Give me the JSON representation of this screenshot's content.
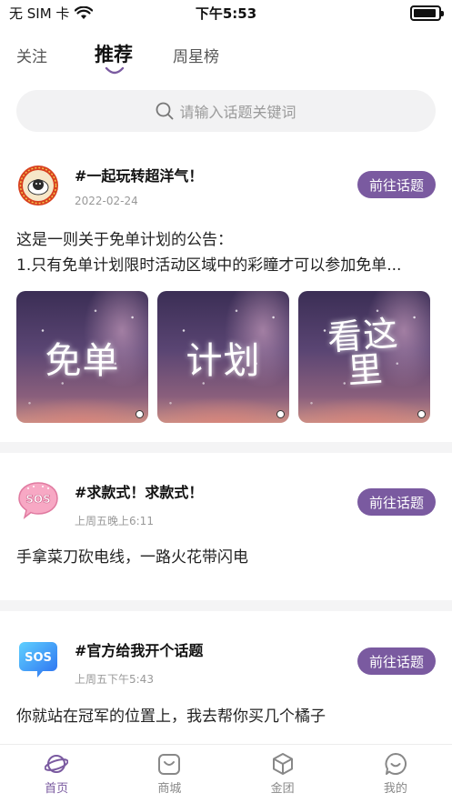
{
  "status_bar": {
    "carrier": "无 SIM 卡",
    "time": "下午5:53"
  },
  "tabs": [
    {
      "label": "关注",
      "active": false
    },
    {
      "label": "推荐",
      "active": true
    },
    {
      "label": "周星榜",
      "active": false
    }
  ],
  "search": {
    "placeholder": "请输入话题关键词"
  },
  "accent_color": "#7a5aa0",
  "posts": [
    {
      "title": "#一起玩转超洋气！",
      "date": "2022-02-24",
      "button": "前往话题",
      "body_line1": "这是一则关于免单计划的公告：",
      "body_line2": "1.只有免单计划限时活动区域中的彩瞳才可以参加免单...",
      "avatar_icon": "sheep-badge-icon",
      "images": [
        {
          "text": "免单"
        },
        {
          "text": "计划"
        },
        {
          "text_top": "看这",
          "text_bottom": "里"
        }
      ]
    },
    {
      "title": "#求款式！求款式！",
      "date": "上周五晚上6:11",
      "button": "前往话题",
      "body": "手拿菜刀砍电线，一路火花带闪电",
      "avatar_icon": "sos-pink-bubble-icon"
    },
    {
      "title": "#官方给我开个话题",
      "date": "上周五下午5:43",
      "button": "前往话题",
      "body": "你就站在冠军的位置上，我去帮你买几个橘子",
      "avatar_icon": "sos-blue-bubble-icon"
    }
  ],
  "bottom_nav": [
    {
      "label": "首页",
      "icon": "planet-icon",
      "active": true
    },
    {
      "label": "商城",
      "icon": "shop-bag-icon",
      "active": false
    },
    {
      "label": "金团",
      "icon": "cube-icon",
      "active": false
    },
    {
      "label": "我的",
      "icon": "smiley-bubble-icon",
      "active": false
    }
  ]
}
